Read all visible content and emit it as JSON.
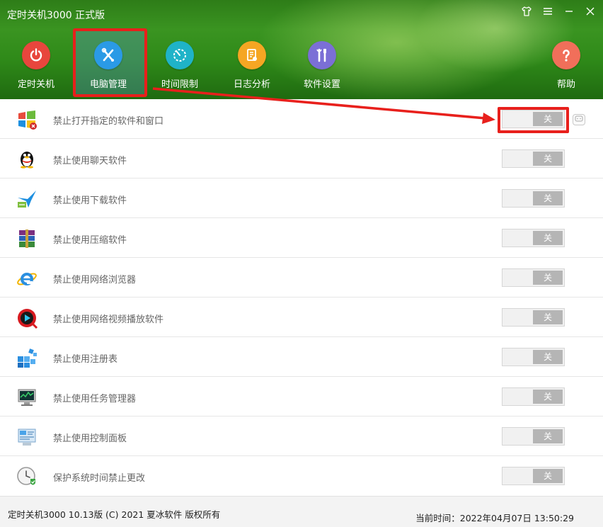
{
  "window": {
    "title": "定时关机3000 正式版",
    "controls": [
      "shirt-icon",
      "menu-icon",
      "minimize-icon",
      "close-icon"
    ]
  },
  "nav": {
    "items": [
      {
        "label": "定时关机",
        "icon": "power-icon",
        "color": "#e8463d"
      },
      {
        "label": "电脑管理",
        "icon": "tools-icon",
        "color": "#2a9ae6",
        "active": true
      },
      {
        "label": "时间限制",
        "icon": "timer-icon",
        "color": "#1fb3c8"
      },
      {
        "label": "日志分析",
        "icon": "log-icon",
        "color": "#f5a623"
      },
      {
        "label": "软件设置",
        "icon": "settings-icon",
        "color": "#7b6fd6"
      }
    ],
    "help": {
      "label": "帮助",
      "icon": "help-icon",
      "color": "#f16f5a"
    }
  },
  "list": {
    "rows": [
      {
        "text": "禁止打开指定的软件和窗口",
        "icon": "windows-block-icon",
        "toggle": "关",
        "highlighted": true
      },
      {
        "text": "禁止使用聊天软件",
        "icon": "qq-penguin-icon",
        "toggle": "关"
      },
      {
        "text": "禁止使用下载软件",
        "icon": "download-bird-icon",
        "toggle": "关"
      },
      {
        "text": "禁止使用压缩软件",
        "icon": "winrar-icon",
        "toggle": "关"
      },
      {
        "text": "禁止使用网络浏览器",
        "icon": "ie-browser-icon",
        "toggle": "关"
      },
      {
        "text": "禁止使用网络视频播放软件",
        "icon": "video-player-icon",
        "toggle": "关"
      },
      {
        "text": "禁止使用注册表",
        "icon": "registry-icon",
        "toggle": "关"
      },
      {
        "text": "禁止使用任务管理器",
        "icon": "task-manager-icon",
        "toggle": "关"
      },
      {
        "text": "禁止使用控制面板",
        "icon": "control-panel-icon",
        "toggle": "关"
      },
      {
        "text": "保护系统时间禁止更改",
        "icon": "clock-shield-icon",
        "toggle": "关"
      }
    ]
  },
  "footer": {
    "copyright": "定时关机3000 10.13版 (C) 2021  夏冰软件 版权所有",
    "current_time": "当前时间：2022年04月07日 13:50:29"
  },
  "annotation": {
    "color": "#e8201c"
  }
}
